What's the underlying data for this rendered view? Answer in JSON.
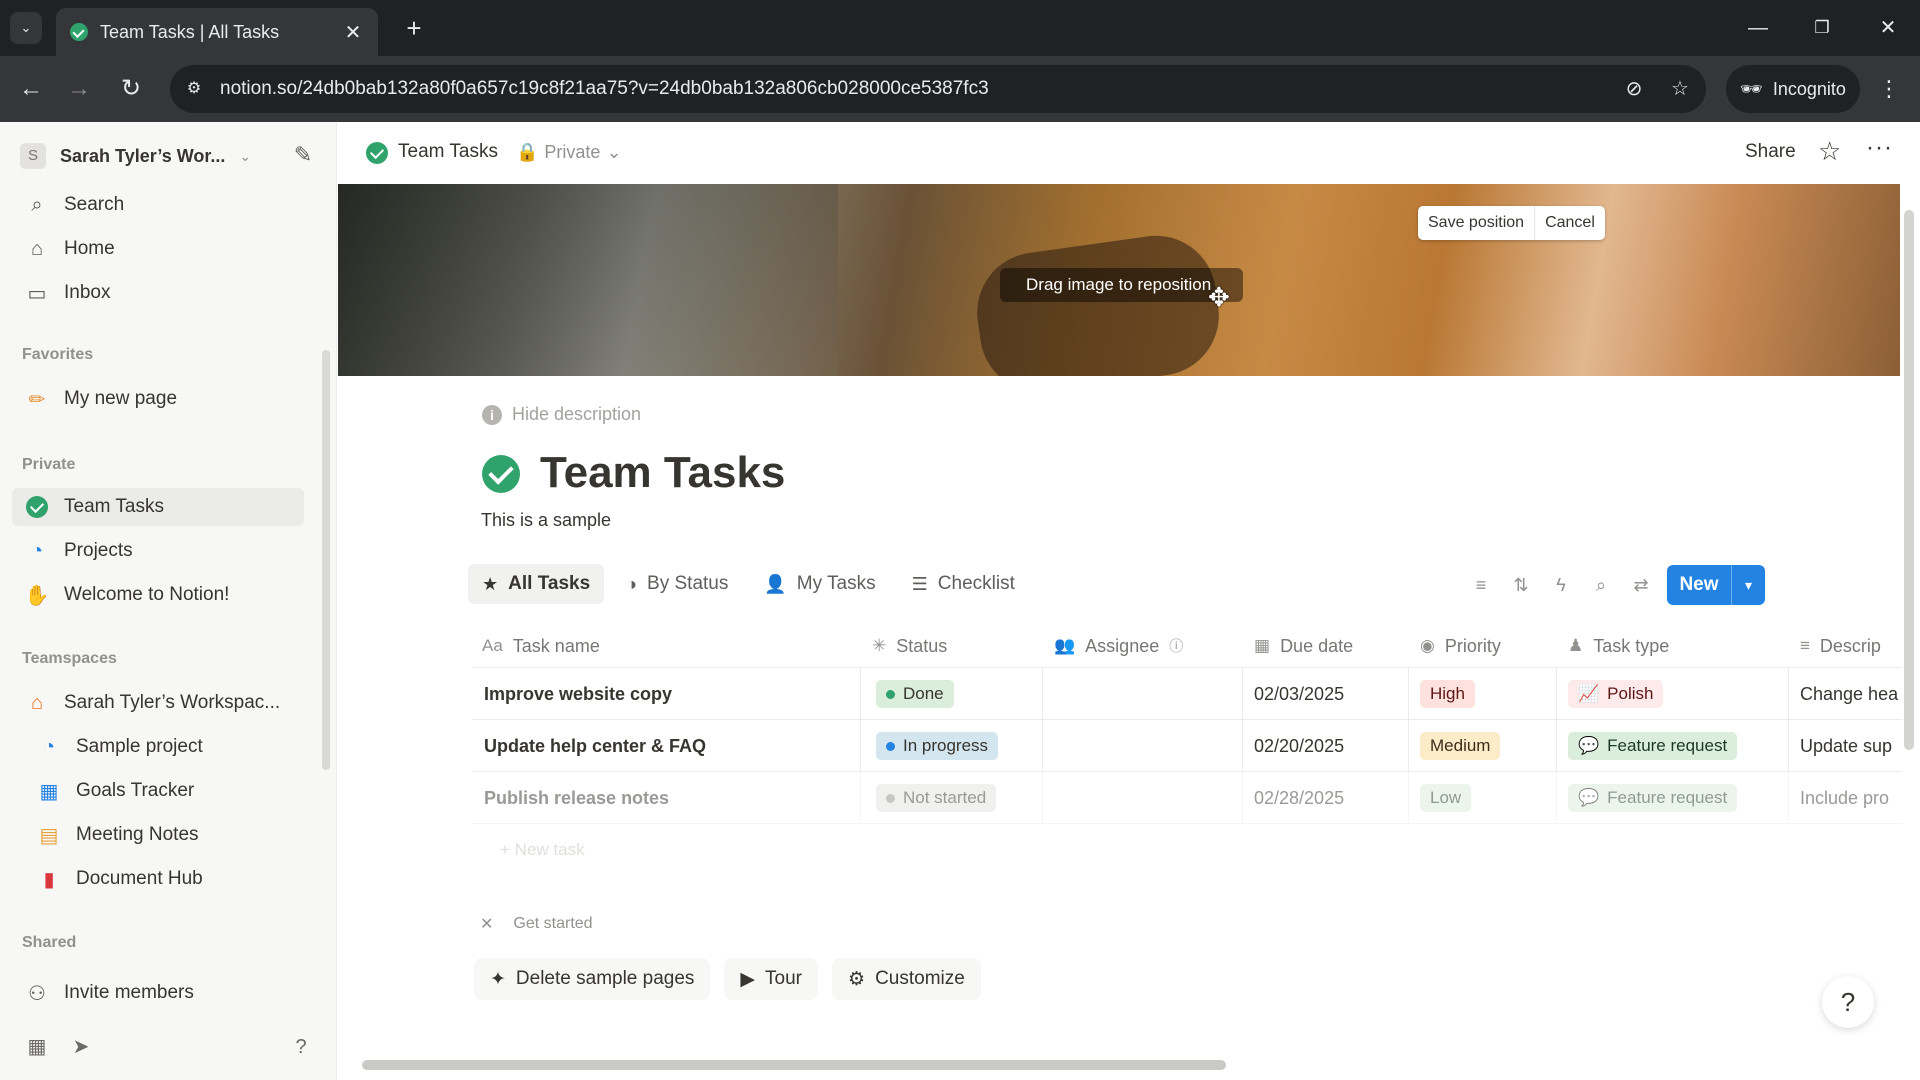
{
  "browser": {
    "tab_title": "Team Tasks | All Tasks",
    "url": "notion.so/24db0bab132a80f0a657c19c8f21aa75?v=24db0bab132a806cb028000ce5387fc3",
    "incognito_label": "Incognito"
  },
  "sidebar": {
    "workspace_name": "Sarah Tyler’s Wor...",
    "workspace_initial": "S",
    "top_items": [
      {
        "label": "Search"
      },
      {
        "label": "Home"
      },
      {
        "label": "Inbox"
      }
    ],
    "favorites_heading": "Favorites",
    "favorites": [
      {
        "label": "My new page"
      }
    ],
    "private_heading": "Private",
    "private": [
      {
        "label": "Team Tasks"
      },
      {
        "label": "Projects"
      },
      {
        "label": "Welcome to Notion!"
      }
    ],
    "teamspaces_heading": "Teamspaces",
    "teamspaces": [
      {
        "label": "Sarah Tyler’s Workspac..."
      },
      {
        "label": "Sample project"
      },
      {
        "label": "Goals Tracker"
      },
      {
        "label": "Meeting Notes"
      },
      {
        "label": "Document Hub"
      }
    ],
    "shared_heading": "Shared",
    "invite_label": "Invite members"
  },
  "topbar": {
    "breadcrumb_title": "Team Tasks",
    "privacy": "Private",
    "share_label": "Share"
  },
  "cover": {
    "drag_hint": "Drag image to reposition",
    "save_position": "Save position",
    "cancel": "Cancel"
  },
  "page": {
    "hide_description": "Hide description",
    "title": "Team Tasks",
    "description": "This is a sample"
  },
  "views": [
    {
      "label": "All Tasks",
      "icon": "star-icon"
    },
    {
      "label": "By Status",
      "icon": "status-icon"
    },
    {
      "label": "My Tasks",
      "icon": "person-icon"
    },
    {
      "label": "Checklist",
      "icon": "checklist-icon"
    }
  ],
  "new_button": "New",
  "table": {
    "columns": {
      "task_name": "Task name",
      "status": "Status",
      "assignee": "Assignee",
      "due_date": "Due date",
      "priority": "Priority",
      "task_type": "Task type",
      "description": "Descrip"
    },
    "rows": [
      {
        "task": "Improve website copy",
        "status": "Done",
        "status_color": "#2fa36b",
        "status_bg": "#dbeddb",
        "due": "02/03/2025",
        "priority": "High",
        "priority_bg": "#ffe2dd",
        "priority_color": "#5d1715",
        "type": "Polish",
        "type_bg": "#fdebec",
        "type_color": "#5d1715",
        "desc": "Change hea"
      },
      {
        "task": "Update help center & FAQ",
        "status": "In progress",
        "status_color": "#2383e2",
        "status_bg": "#d3e5ef",
        "due": "02/20/2025",
        "priority": "Medium",
        "priority_bg": "#fdecc8",
        "priority_color": "#402c1b",
        "type": "Feature request",
        "type_bg": "#dbeddb",
        "type_color": "#1c3829",
        "desc": "Update sup"
      },
      {
        "task": "Publish release notes",
        "status": "Not started",
        "status_color": "#91918e",
        "status_bg": "#e3e2e0",
        "due": "02/28/2025",
        "priority": "Low",
        "priority_bg": "#dbeddb",
        "priority_color": "#1c3829",
        "type": "Feature request",
        "type_bg": "#dbeddb",
        "type_color": "#1c3829",
        "desc": "Include pro"
      }
    ],
    "new_task_label": "New task"
  },
  "get_started": {
    "label": "Get started",
    "buttons": [
      {
        "label": "Delete sample pages"
      },
      {
        "label": "Tour"
      },
      {
        "label": "Customize"
      }
    ]
  }
}
